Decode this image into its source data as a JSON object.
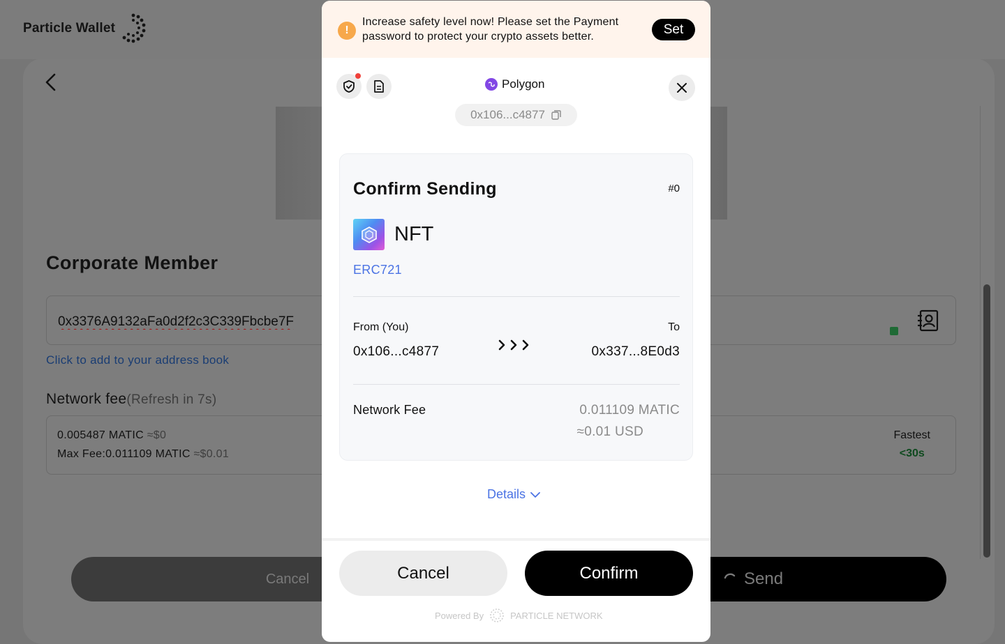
{
  "app": {
    "name": "Particle Wallet"
  },
  "page": {
    "member_title": "Corporate Member",
    "address_value": "0x3376A9132aFa0d2f2c3C339Fbcbe7F",
    "address_book_link": "Click to add to your address book",
    "network_fee_title": "Network fee",
    "network_fee_refresh": "(Refresh in 7s)",
    "fee_amount": "0.005487 MATIC",
    "fee_amount_usd": "≈$0",
    "max_fee": "Max Fee:0.011109 MATIC",
    "max_fee_usd": "≈$0.01",
    "speed_label": "Fastest",
    "speed_time": "<30s",
    "cancel_label": "Cancel",
    "send_label": "Send"
  },
  "modal": {
    "banner": {
      "text": "Increase safety level now! Please set the Payment password to protect your crypto assets better.",
      "set_label": "Set"
    },
    "network_name": "Polygon",
    "wallet_address": "0x106...c4877",
    "card": {
      "title": "Confirm Sending",
      "nonce": "#0",
      "nft_name": "NFT",
      "token_standard": "ERC721",
      "from_label": "From (You)",
      "to_label": "To",
      "from_address": "0x106...c4877",
      "to_address": "0x337...8E0d3",
      "fee_label": "Network Fee",
      "fee_value": "0.011109 MATIC",
      "fee_usd": "≈0.01 USD"
    },
    "details_label": "Details",
    "cancel_label": "Cancel",
    "confirm_label": "Confirm",
    "powered_by": "Powered By",
    "powered_brand": "PARTICLE NETWORK"
  },
  "colors": {
    "accent_blue": "#4b73e4",
    "warning_orange": "#f7a84b",
    "polygon_purple": "#8247e5",
    "fast_green": "#0f4a1f"
  }
}
